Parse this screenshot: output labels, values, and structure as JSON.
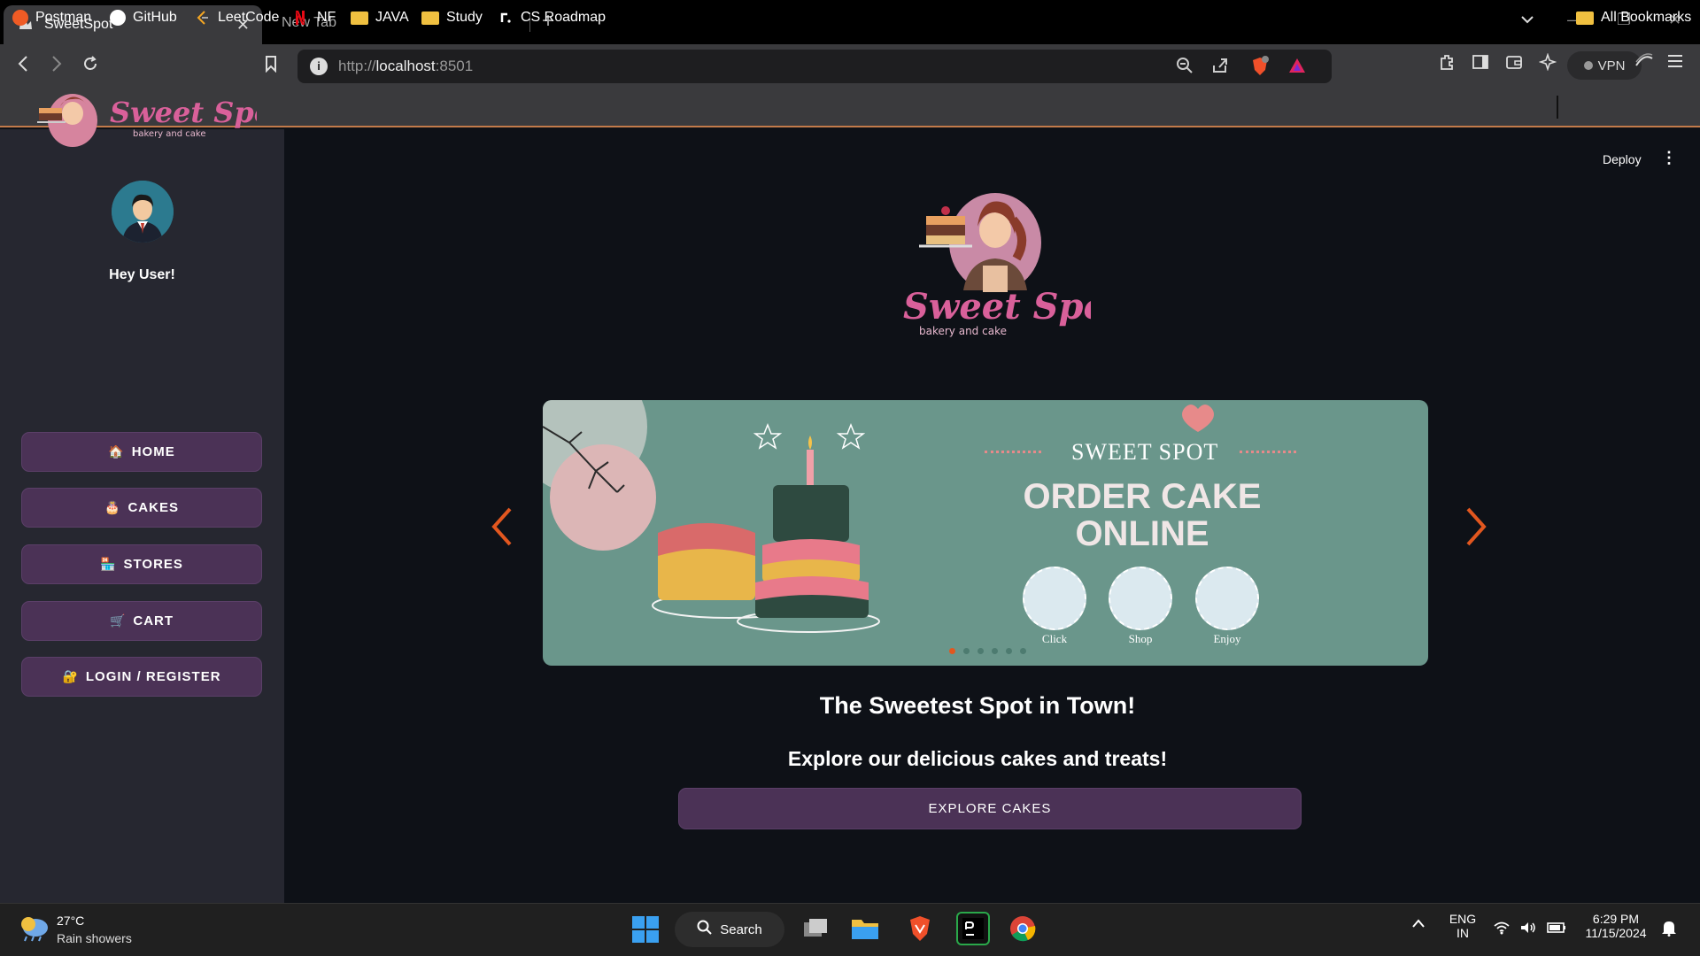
{
  "browser": {
    "active_tab": "SweetSpot",
    "inactive_tab": "New Tab",
    "url_scheme": "http://",
    "url_host": "localhost",
    "url_port": ":8501",
    "vpn_label": "VPN",
    "bookmarks": [
      "Postman",
      "GitHub",
      "LeetCode",
      "NF",
      "JAVA",
      "Study",
      "CS Roadmap"
    ],
    "all_bookmarks": "All Bookmarks",
    "shield_badge": "1"
  },
  "sidebar": {
    "logo_title": "Sweet Spot",
    "logo_subtitle": "bakery and cake",
    "greeting": "Hey User!",
    "nav": [
      {
        "emoji": "🏠",
        "label": "HOME"
      },
      {
        "emoji": "🎂",
        "label": "CAKES"
      },
      {
        "emoji": "🏪",
        "label": "STORES"
      },
      {
        "emoji": "🛒",
        "label": "CART"
      },
      {
        "emoji": "🔐",
        "label": "LOGIN / REGISTER"
      }
    ]
  },
  "header": {
    "deploy_label": "Deploy",
    "menu_icon": "⋮"
  },
  "main": {
    "logo_title": "Sweet Spot",
    "logo_subtitle": "bakery and cake",
    "banner": {
      "brand": "SWEET SPOT",
      "heading": "ORDER CAKE ONLINE",
      "steps": [
        "Click",
        "Shop",
        "Enjoy"
      ],
      "slides_count": 6,
      "active_slide": 1
    },
    "headline": "The Sweetest Spot in Town!",
    "subheadline": "Explore our delicious cakes and treats!",
    "cta_label": "EXPLORE CAKES"
  },
  "taskbar": {
    "temperature": "27°C",
    "weather": "Rain showers",
    "search_label": "Search",
    "lang_top": "ENG",
    "lang_bottom": "IN",
    "time": "6:29 PM",
    "date": "11/15/2024"
  },
  "colors": {
    "accent_orange": "#e2571f",
    "button_purple": "#4b3256",
    "banner_teal": "#6a968b",
    "brand_pink": "#d9609a"
  }
}
